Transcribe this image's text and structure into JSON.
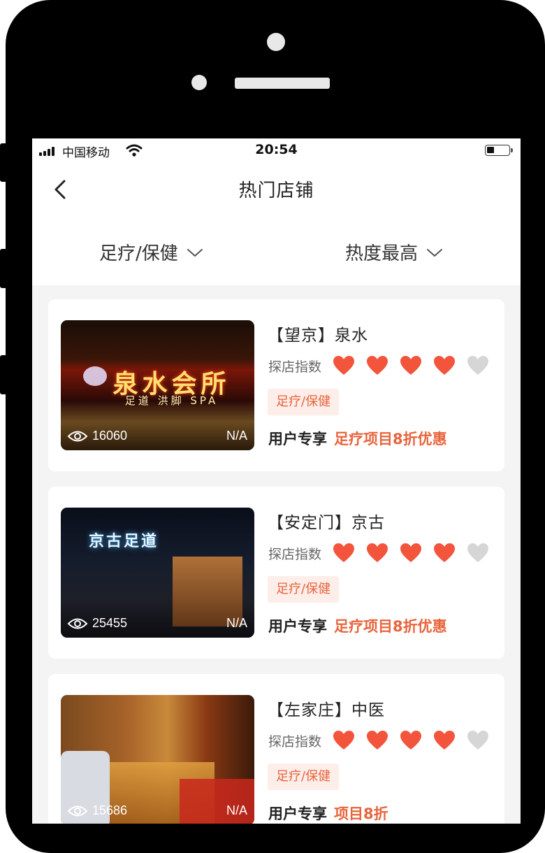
{
  "status_bar": {
    "carrier": "中国移动",
    "time": "20:54"
  },
  "nav": {
    "title": "热门店铺"
  },
  "filters": {
    "category": "足疗/保健",
    "sort": "热度最高"
  },
  "shops": [
    {
      "name": "【望京】泉水",
      "rating_label": "探店指数",
      "rating": 4,
      "rating_max": 5,
      "tag": "足疗/保健",
      "offer_label": "用户专享",
      "offer": "足疗项目8折优惠",
      "views": "16060",
      "badge": "N/A",
      "sign_text": "泉水会所",
      "sign_sub": "足道 洪脚 SPA"
    },
    {
      "name": "【安定门】京古",
      "rating_label": "探店指数",
      "rating": 4,
      "rating_max": 5,
      "tag": "足疗/保健",
      "offer_label": "用户专享",
      "offer": "足疗项目8折优惠",
      "views": "25455",
      "badge": "N/A",
      "sign_text": "京古足道"
    },
    {
      "name": "【左家庄】中医",
      "rating_label": "探店指数",
      "rating": 4,
      "rating_max": 5,
      "tag": "足疗/保健",
      "offer_label": "用户专享",
      "offer": "项目8折",
      "views": "15686",
      "badge": "N/A"
    }
  ],
  "colors": {
    "accent": "#e8643c",
    "heart_on": "#f2543c",
    "heart_off": "#d6d6d6",
    "tag_bg": "#fdeeea",
    "page_bg": "#f4f4f4"
  }
}
